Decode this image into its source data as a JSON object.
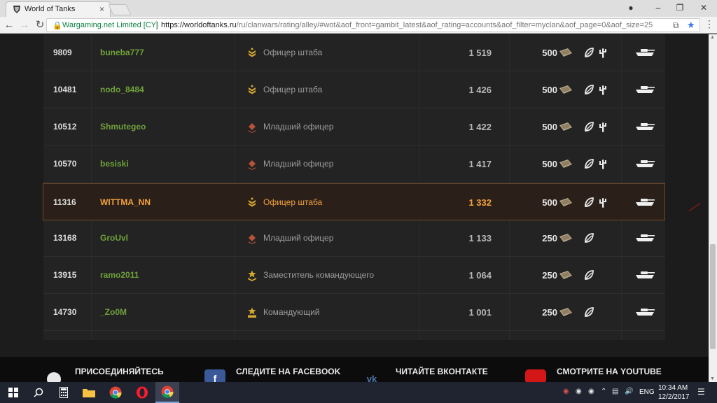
{
  "browser": {
    "tab_title": "World of Tanks",
    "tab_close": "×",
    "site_identity": "Wargaming.net Limited [CY]",
    "url_host": "https://worldoftanks.ru",
    "url_path": "/ru/clanwars/rating/alley/#wot&aof_front=gambit_latest&aof_rating=accounts&aof_filter=myclan&aof_page=0&aof_size=25"
  },
  "rows": [
    {
      "rank": "9809",
      "name": "buneba777",
      "role": "Офицер штаба",
      "rank_icon": "staff-officer-icon",
      "rating": "1 519",
      "reward": "500",
      "has_cactus": true
    },
    {
      "rank": "10481",
      "name": "nodo_8484",
      "role": "Офицер штаба",
      "rank_icon": "staff-officer-icon",
      "rating": "1 426",
      "reward": "500",
      "has_cactus": true
    },
    {
      "rank": "10512",
      "name": "Shmutegeo",
      "role": "Младший офицер",
      "rank_icon": "junior-officer-icon",
      "rating": "1 422",
      "reward": "500",
      "has_cactus": true
    },
    {
      "rank": "10570",
      "name": "besiski",
      "role": "Младший офицер",
      "rank_icon": "junior-officer-icon",
      "rating": "1 417",
      "reward": "500",
      "has_cactus": true
    },
    {
      "rank": "11316",
      "name": "WITTMA_NN",
      "role": "Офицер штаба",
      "rank_icon": "staff-officer-icon",
      "rating": "1 332",
      "reward": "500",
      "has_cactus": true,
      "highlight": true
    },
    {
      "rank": "13168",
      "name": "GroUvl",
      "role": "Младший офицер",
      "rank_icon": "junior-officer-icon",
      "rating": "1 133",
      "reward": "250",
      "has_cactus": false
    },
    {
      "rank": "13915",
      "name": "ramo2011",
      "role": "Заместитель командующего",
      "rank_icon": "deputy-commander-icon",
      "rating": "1 064",
      "reward": "250",
      "has_cactus": false
    },
    {
      "rank": "14730",
      "name": "_Zo0M",
      "role": "Командующий",
      "rank_icon": "commander-icon",
      "rating": "1 001",
      "reward": "250",
      "has_cactus": false
    }
  ],
  "footer": {
    "join": "ПРИСОЕДИНЯЙТЕСЬ",
    "facebook": "СЛЕДИТЕ НА FACEBOOK",
    "vk": "ЧИТАЙТЕ ВКОНТАКТЕ",
    "youtube": "СМОТРИТЕ НА YOUTUBE"
  },
  "taskbar": {
    "lang": "ENG",
    "time": "10:34 AM",
    "date": "12/2/2017"
  },
  "colors": {
    "name_green": "#6fa13a",
    "highlight_orange": "#f3a13e",
    "brand_dark": "#1c1c1c"
  }
}
